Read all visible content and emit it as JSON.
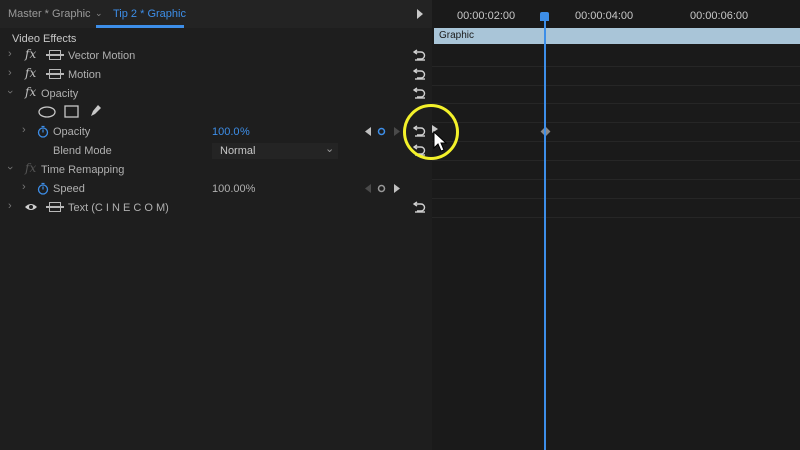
{
  "tabs": [
    {
      "label": "Master * Graphic"
    },
    {
      "label": "Tip 2 * Graphic"
    }
  ],
  "panel": {
    "header": "Video Effects",
    "effects": {
      "vector_motion": "Vector Motion",
      "motion": "Motion",
      "opacity": "Opacity",
      "opacity_param": "Opacity",
      "opacity_value": "100.0",
      "opacity_unit": "%",
      "blend_mode_label": "Blend Mode",
      "blend_mode_value": "Normal",
      "time_remapping": "Time Remapping",
      "speed_label": "Speed",
      "speed_value": "100.00%",
      "text_layer": "Text (C I N E C O M)"
    }
  },
  "timeline": {
    "timecodes": [
      "00:00:02:00",
      "00:00:04:00",
      "00:00:06:00"
    ],
    "clip_name": "Graphic"
  },
  "colors": {
    "accent": "#3d8ee8",
    "highlight": "#f3f12a",
    "clip": "#a9c5d8"
  }
}
